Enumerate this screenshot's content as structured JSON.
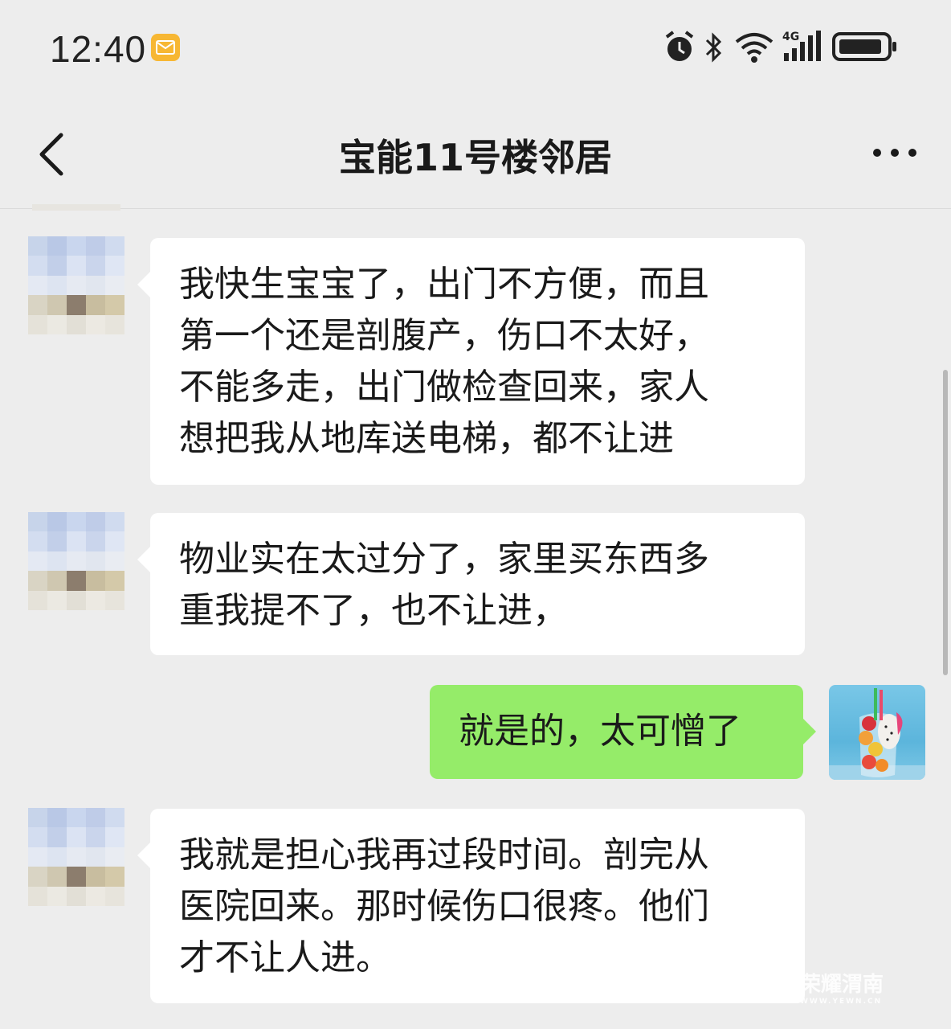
{
  "status_bar": {
    "time": "12:40",
    "network_label": "4G",
    "icons": [
      "mail-notification-icon",
      "alarm-icon",
      "bluetooth-icon",
      "wifi-icon",
      "cellular-signal-icon",
      "battery-icon"
    ]
  },
  "header": {
    "title": "宝能11号楼邻居",
    "back_icon": "chevron-left-icon",
    "more_icon": "more-dots-icon"
  },
  "messages": [
    {
      "side": "left",
      "lines": [
        "我快生宝宝了，出门不方便，而且",
        "第一个还是剖腹产，伤口不太好，",
        "不能多走，出门做检查回来，家人",
        "想把我从地库送电梯，都不让进"
      ]
    },
    {
      "side": "left",
      "lines": [
        "物业实在太过分了，家里买东西多",
        "重我提不了，也不让进，"
      ]
    },
    {
      "side": "right",
      "lines": [
        "就是的，太可憎了"
      ]
    },
    {
      "side": "left",
      "lines": [
        "我就是担心我再过段时间。剖完从",
        "医院回来。那时候伤口很疼。他们",
        "才不让人进。"
      ]
    }
  ],
  "watermark": {
    "text": "荣耀渭南",
    "sub": "WWW.YEWN.CN"
  },
  "colors": {
    "background": "#ededed",
    "bubble_left": "#ffffff",
    "bubble_right": "#95ec69",
    "mail_badge": "#f7b733"
  }
}
